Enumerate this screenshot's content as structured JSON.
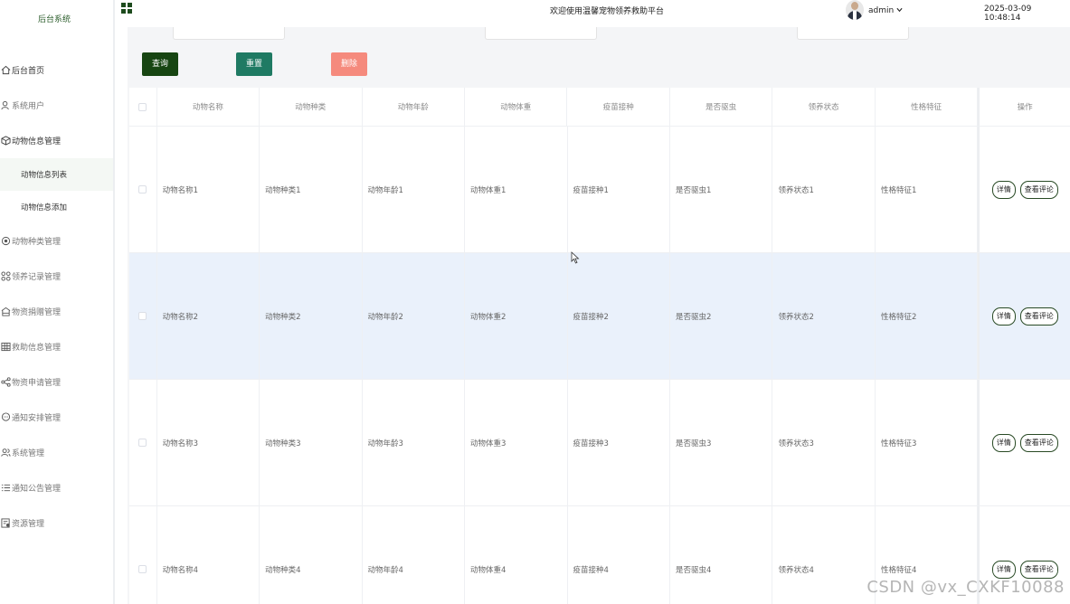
{
  "sidebar": {
    "brand": "后台系统",
    "items": [
      {
        "label": "后台首页",
        "icon": "home-icon"
      },
      {
        "label": "系统用户",
        "icon": "user-icon"
      },
      {
        "label": "动物信息管理",
        "icon": "cube-icon",
        "children": [
          "动物信息列表",
          "动物信息添加"
        ],
        "active_child": "动物信息列表"
      },
      {
        "label": "动物种类管理",
        "icon": "target-icon"
      },
      {
        "label": "领养记录管理",
        "icon": "apps-icon"
      },
      {
        "label": "物资捐赠管理",
        "icon": "home-outline-icon"
      },
      {
        "label": "救助信息管理",
        "icon": "grid-table-icon"
      },
      {
        "label": "物资申请管理",
        "icon": "share-icon"
      },
      {
        "label": "通知安排管理",
        "icon": "chat-icon"
      },
      {
        "label": "系统管理",
        "icon": "users-icon"
      },
      {
        "label": "通知公告管理",
        "icon": "list-icon"
      },
      {
        "label": "资源管理",
        "icon": "resource-icon"
      }
    ]
  },
  "topbar": {
    "welcome": "欢迎使用温馨宠物领养救助平台",
    "user": "admin",
    "datetime": "2025-03-09 10:48:14"
  },
  "toolbar": {
    "query_label": "查询",
    "reset_label": "重置",
    "delete_label": "删除"
  },
  "table": {
    "columns": [
      "动物名称",
      "动物种类",
      "动物年龄",
      "动物体重",
      "疫苗接种",
      "是否驱虫",
      "领养状态",
      "性格特征",
      "操作"
    ],
    "rows": [
      [
        "动物名称1",
        "动物种类1",
        "动物年龄1",
        "动物体重1",
        "疫苗接种1",
        "是否驱虫1",
        "领养状态1",
        "性格特征1"
      ],
      [
        "动物名称2",
        "动物种类2",
        "动物年龄2",
        "动物体重2",
        "疫苗接种2",
        "是否驱虫2",
        "领养状态2",
        "性格特征2"
      ],
      [
        "动物名称3",
        "动物种类3",
        "动物年龄3",
        "动物体重3",
        "疫苗接种3",
        "是否驱虫3",
        "领养状态3",
        "性格特征3"
      ],
      [
        "动物名称4",
        "动物种类4",
        "动物年龄4",
        "动物体重4",
        "疫苗接种4",
        "是否驱虫4",
        "领养状态4",
        "性格特征4"
      ]
    ],
    "row_actions": {
      "detail": "详情",
      "comments": "查看评论"
    }
  },
  "watermark": "CSDN @vx_CXKF10088",
  "colors": {
    "accent_dark_green": "#174512",
    "reset_green": "#1f7a63",
    "delete_salmon": "#f58a7d",
    "row_highlight": "#eaf1fb"
  }
}
